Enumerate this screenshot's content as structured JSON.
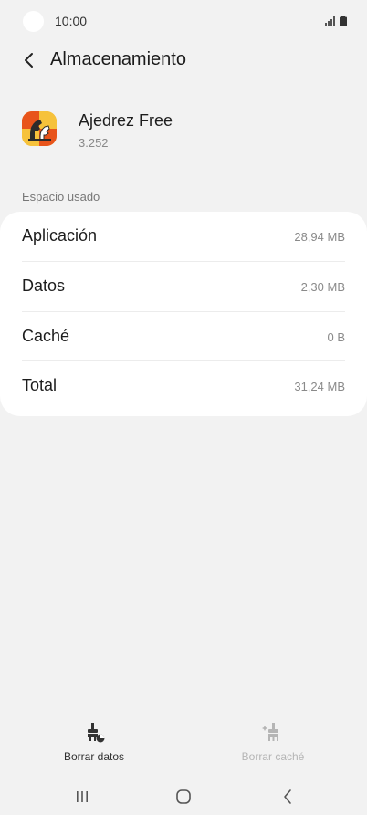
{
  "status_bar": {
    "time": "10:00"
  },
  "header": {
    "title": "Almacenamiento"
  },
  "app": {
    "name": "Ajedrez Free",
    "version": "3.252"
  },
  "section": {
    "label": "Espacio usado"
  },
  "storage": {
    "rows": [
      {
        "label": "Aplicación",
        "value": "28,94 MB"
      },
      {
        "label": "Datos",
        "value": "2,30 MB"
      },
      {
        "label": "Caché",
        "value": "0 B"
      },
      {
        "label": "Total",
        "value": "31,24 MB"
      }
    ]
  },
  "actions": {
    "clear_data": {
      "label": "Borrar datos",
      "enabled": true
    },
    "clear_cache": {
      "label": "Borrar caché",
      "enabled": false
    }
  },
  "colors": {
    "background": "#f2f2f2",
    "card": "#ffffff",
    "muted_text": "#8a8a8a",
    "disabled_text": "#b5b5b5"
  },
  "icons": {
    "back": "chevron-left-icon",
    "clear_data": "broom-pie-icon",
    "clear_cache": "broom-sparkle-icon",
    "nav_recents": "recents-icon",
    "nav_home": "home-icon",
    "nav_back": "back-icon"
  }
}
